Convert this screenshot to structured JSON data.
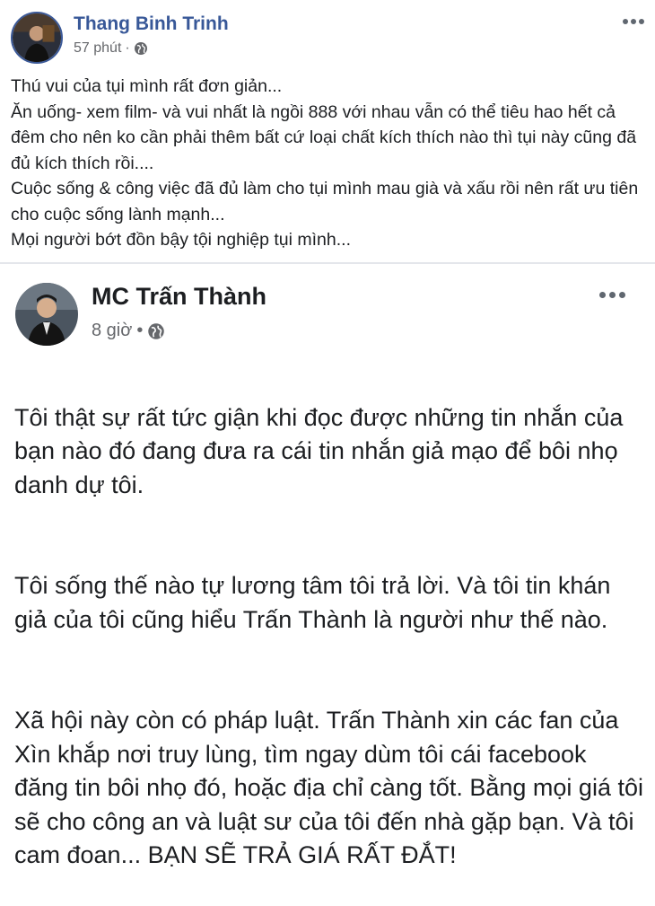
{
  "posts": [
    {
      "author": "Thang Binh Trinh",
      "time": "57 phút",
      "separator": "·",
      "privacy_icon": "globe-icon",
      "more_icon": "more-icon",
      "text": "Thú vui của tụi mình rất đơn giản...\nĂn uống- xem film- và vui nhất là ngồi 888 với nhau vẫn có thể tiêu hao hết cả đêm cho nên ko cần phải thêm bất cứ loại chất kích thích nào thì tụi này cũng đã đủ kích thích rồi....\nCuộc sống & công việc đã đủ làm cho tụi mình mau già và xấu rồi nên rất ưu tiên cho cuộc sống lành mạnh...\nMọi người bớt đồn bậy tội nghiệp tụi mình..."
    },
    {
      "author": "MC Trấn Thành",
      "time": "8 giờ",
      "separator": "•",
      "privacy_icon": "globe-icon",
      "more_icon": "more-icon",
      "paragraphs": [
        "Tôi thật sự rất tức giận khi đọc được những tin nhắn của bạn nào đó đang đưa ra cái tin nhắn giả mạo để bôi nhọ danh dự tôi.",
        "Tôi sống thế nào tự lương tâm tôi trả lời. Và tôi tin khán giả của tôi cũng hiểu Trấn Thành là người như thế nào.",
        "Xã hội này còn có pháp luật. Trấn Thành xin các fan của Xìn khắp nơi truy lùng, tìm ngay dùm tôi cái facebook đăng tin bôi nhọ đó, hoặc địa chỉ càng tốt. Bằng mọi giá tôi sẽ cho công an và luật sư của tôi đến nhà gặp bạn. Và tôi cam đoan... BẠN SẼ TRẢ GIÁ RẤT ĐẮT!"
      ]
    }
  ],
  "colors": {
    "name_link": "#385898",
    "secondary_text": "#65676b",
    "divider": "#e4e6eb"
  }
}
